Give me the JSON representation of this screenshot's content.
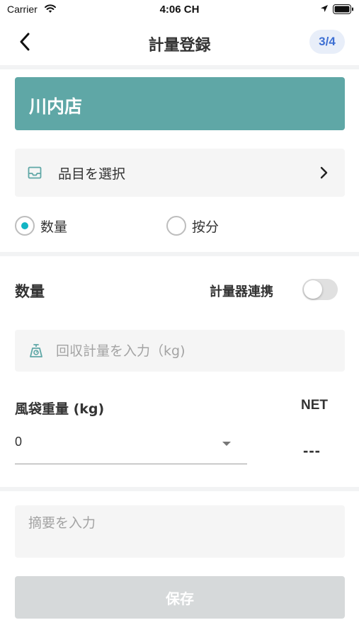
{
  "status_bar": {
    "carrier": "Carrier",
    "time": "4:06 CH",
    "icons": [
      "wifi-icon",
      "location-arrow-icon",
      "battery-icon"
    ]
  },
  "nav": {
    "back_icon": "chevron-left-icon",
    "title": "計量登録",
    "step": "3/4"
  },
  "store": {
    "name": "川内店"
  },
  "item_select": {
    "icon": "inbox-icon",
    "label": "品目を選択",
    "chevron": "chevron-right-icon"
  },
  "allocation_mode": {
    "options": [
      {
        "label": "数量",
        "selected": true
      },
      {
        "label": "按分",
        "selected": false
      }
    ]
  },
  "quantity_section": {
    "title": "数量",
    "scale_link_label": "計量器連携",
    "scale_link_enabled": false,
    "weight_input": {
      "icon": "scale-icon",
      "value": "",
      "placeholder": "回収計量を入力（kg)"
    },
    "bag_weight": {
      "label": "風袋重量 (kg)",
      "selected_value": "0"
    },
    "net": {
      "label": "NET",
      "value": "---"
    }
  },
  "memo": {
    "value": "",
    "placeholder": "摘要を入力"
  },
  "save_button": {
    "label": "保存"
  },
  "colors": {
    "store_banner": "#5fa7a6",
    "accent_teal": "#12b5c4",
    "step_badge_text": "#3d6fd3",
    "disabled_button": "#d6d9da"
  }
}
